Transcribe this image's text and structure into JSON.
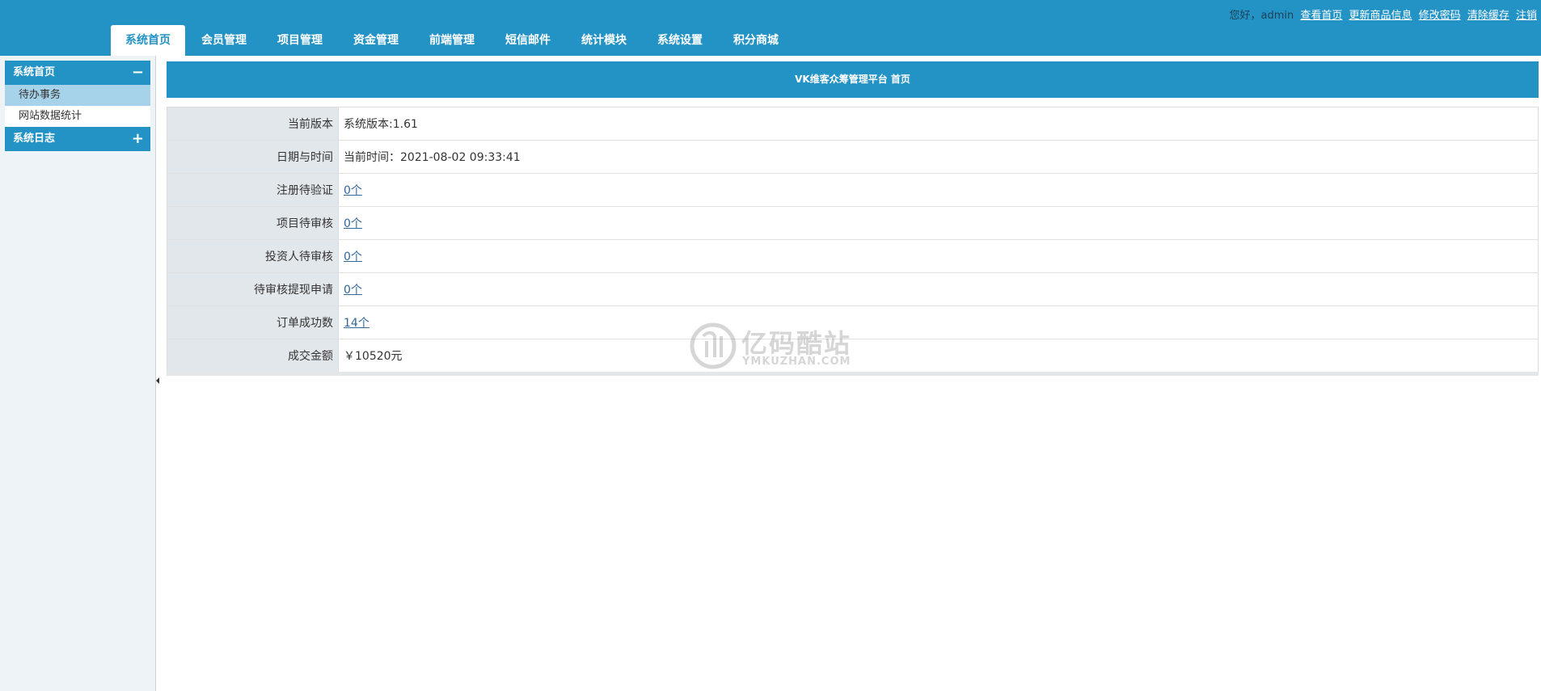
{
  "header": {
    "greeting": "您好，admin",
    "links": [
      "查看首页",
      "更新商品信息",
      "修改密码",
      "清除缓存",
      "注销"
    ],
    "tabs": [
      "系统首页",
      "会员管理",
      "项目管理",
      "资金管理",
      "前端管理",
      "短信邮件",
      "统计模块",
      "系统设置",
      "积分商城"
    ],
    "active_tab": "系统首页"
  },
  "sidebar": {
    "groups": [
      {
        "title": "系统首页",
        "toggle": "−",
        "items": [
          "待办事务",
          "网站数据统计"
        ]
      },
      {
        "title": "系统日志",
        "toggle": "+"
      }
    ],
    "active_item": "待办事务"
  },
  "main": {
    "title": "VK维客众筹管理平台 首页",
    "rows": [
      {
        "label": "当前版本",
        "value": "系统版本:1.61"
      },
      {
        "label": "日期与时间",
        "value": "当前时间：2021-08-02 09:33:41"
      },
      {
        "label": "注册待验证",
        "value": "0个"
      },
      {
        "label": "项目待审核",
        "value": "0个"
      },
      {
        "label": "投资人待审核",
        "value": "0个"
      },
      {
        "label": "待审核提现申请",
        "value": "0个"
      },
      {
        "label": "订单成功数",
        "value": "14个"
      },
      {
        "label": "成交金额",
        "value": "￥10520元"
      }
    ]
  },
  "watermark": {
    "title": "亿码酷站",
    "subtitle": "YMKUZHAN.COM"
  },
  "colors": {
    "brand": "#2393c6",
    "sidebar_bg": "#eef3f8",
    "active_item": "#a6d3ea",
    "label_bg": "#e2e7eb",
    "link": "#336699"
  }
}
